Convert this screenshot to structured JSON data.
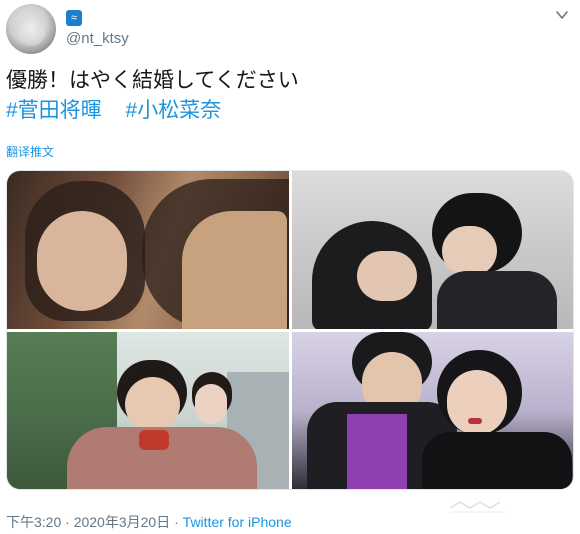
{
  "account": {
    "handle": "@nt_ktsy",
    "profile_badge_icon": "wave-icon"
  },
  "tweet": {
    "text": "優勝！はやく結婚してください",
    "hashtags": [
      "#菅田将暉",
      "#小松菜奈"
    ],
    "translate_label": "翻译推文"
  },
  "meta": {
    "time": "下午3:20",
    "sep1": " · ",
    "date": "2020年3月20日",
    "sep2": " · ",
    "source": "Twitter for iPhone"
  },
  "icons": {
    "menu": "chevron-down-icon"
  },
  "colors": {
    "link": "#1b95e0",
    "text": "#14171a",
    "muted": "#657786"
  }
}
